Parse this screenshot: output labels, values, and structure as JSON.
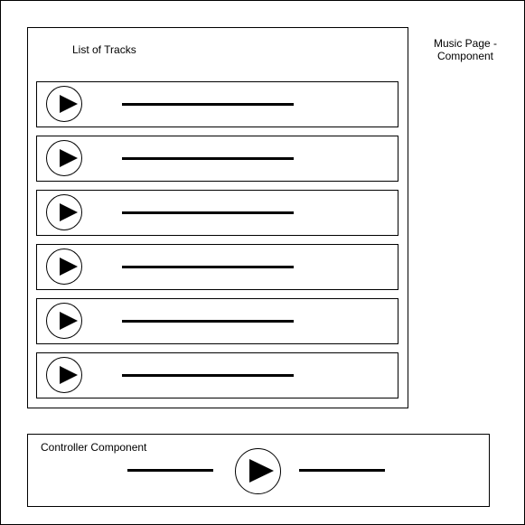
{
  "page_label_line1": "Music Page -",
  "page_label_line2": "Component",
  "tracks_title": "List of Tracks",
  "tracks": [
    {
      "play_icon": "play-icon"
    },
    {
      "play_icon": "play-icon"
    },
    {
      "play_icon": "play-icon"
    },
    {
      "play_icon": "play-icon"
    },
    {
      "play_icon": "play-icon"
    },
    {
      "play_icon": "play-icon"
    }
  ],
  "controller_title": "Controller Component",
  "controller_play_icon": "play-icon"
}
